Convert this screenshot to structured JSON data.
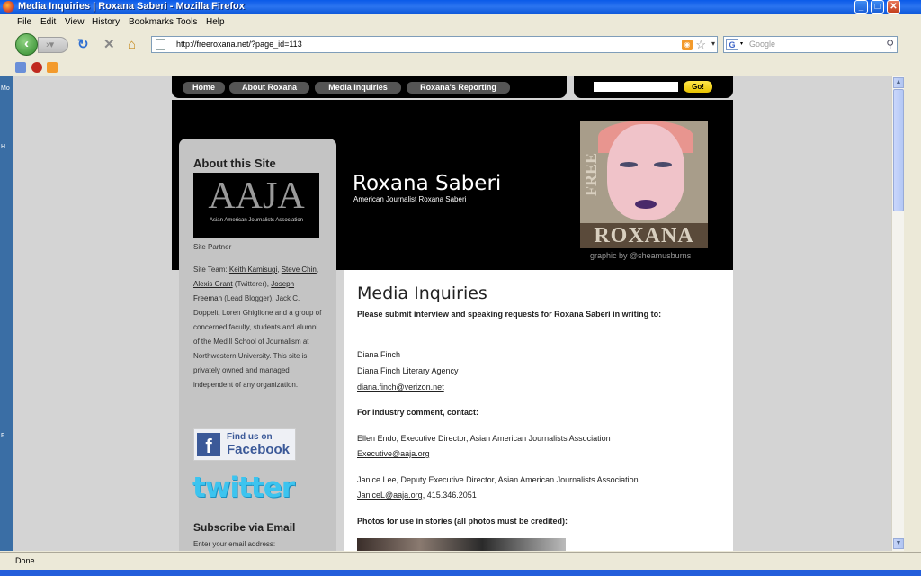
{
  "window": {
    "title": "Media Inquiries | Roxana Saberi - Mozilla Firefox",
    "buttons": {
      "minimize": "_",
      "maximize": "□",
      "close": "✕"
    }
  },
  "menu": [
    "File",
    "Edit",
    "View",
    "History",
    "Bookmarks",
    "Tools",
    "Help"
  ],
  "toolbar": {
    "url": "http://freeroxana.net/?page_id=113",
    "search_placeholder": "Google"
  },
  "status": {
    "text": "Done"
  },
  "site": {
    "nav": [
      "Home",
      "About Roxana",
      "Media Inquiries",
      "Roxana's Reporting"
    ],
    "search_button": "Go!",
    "title": "Roxana Saberi",
    "subtitle": "American Journalist Roxana Saberi",
    "poster_free": "FREE",
    "poster_name": "ROXANA",
    "graphic_credit": "graphic by @sheamusburns"
  },
  "sidebar": {
    "heading": "About this Site",
    "logo_big": "AAJA",
    "logo_small": "Asian American Journalists Association",
    "partner": "Site Partner",
    "team_label": "Site Team:",
    "team_links": [
      "Keith Kamisugi",
      "Steve Chin",
      "Alexis Grant",
      "Joseph Freeman"
    ],
    "team_sep": ", ",
    "team_twitterer": " (Twitterer), ",
    "team_rest": " (Lead Blogger), Jack C. Doppelt, Loren Ghiglione and a group of concerned faculty, students and alumni of the Medill School of Journalism at Northwestern University. This site is privately owned and managed independent of any organization.",
    "facebook_line1": "Find us on",
    "facebook_line2": "Facebook",
    "twitter": "twitter",
    "subscribe_heading": "Subscribe via Email",
    "email_label": "Enter your email address:"
  },
  "main": {
    "title": "Media Inquiries",
    "intro": "Please submit interview and speaking requests for Roxana Saberi in writing to:",
    "contact1_name": "Diana Finch",
    "contact1_agency": "Diana Finch Literary Agency",
    "contact1_email": "diana.finch@verizon.net",
    "industry_heading": "For industry comment, contact:",
    "contact2_title": "Ellen Endo, Executive Director, Asian American Journalists Association",
    "contact2_email": "Executive@aaja.org",
    "contact3_title": "Janice Lee, Deputy Executive Director, Asian American Journalists Association",
    "contact3_email": "JaniceL@aaja.org",
    "contact3_phone": ", 415.346.2051",
    "photos_heading": "Photos for use in stories (all photos must be credited):"
  },
  "left_edge_labels": [
    "Mo",
    "H",
    "F"
  ]
}
